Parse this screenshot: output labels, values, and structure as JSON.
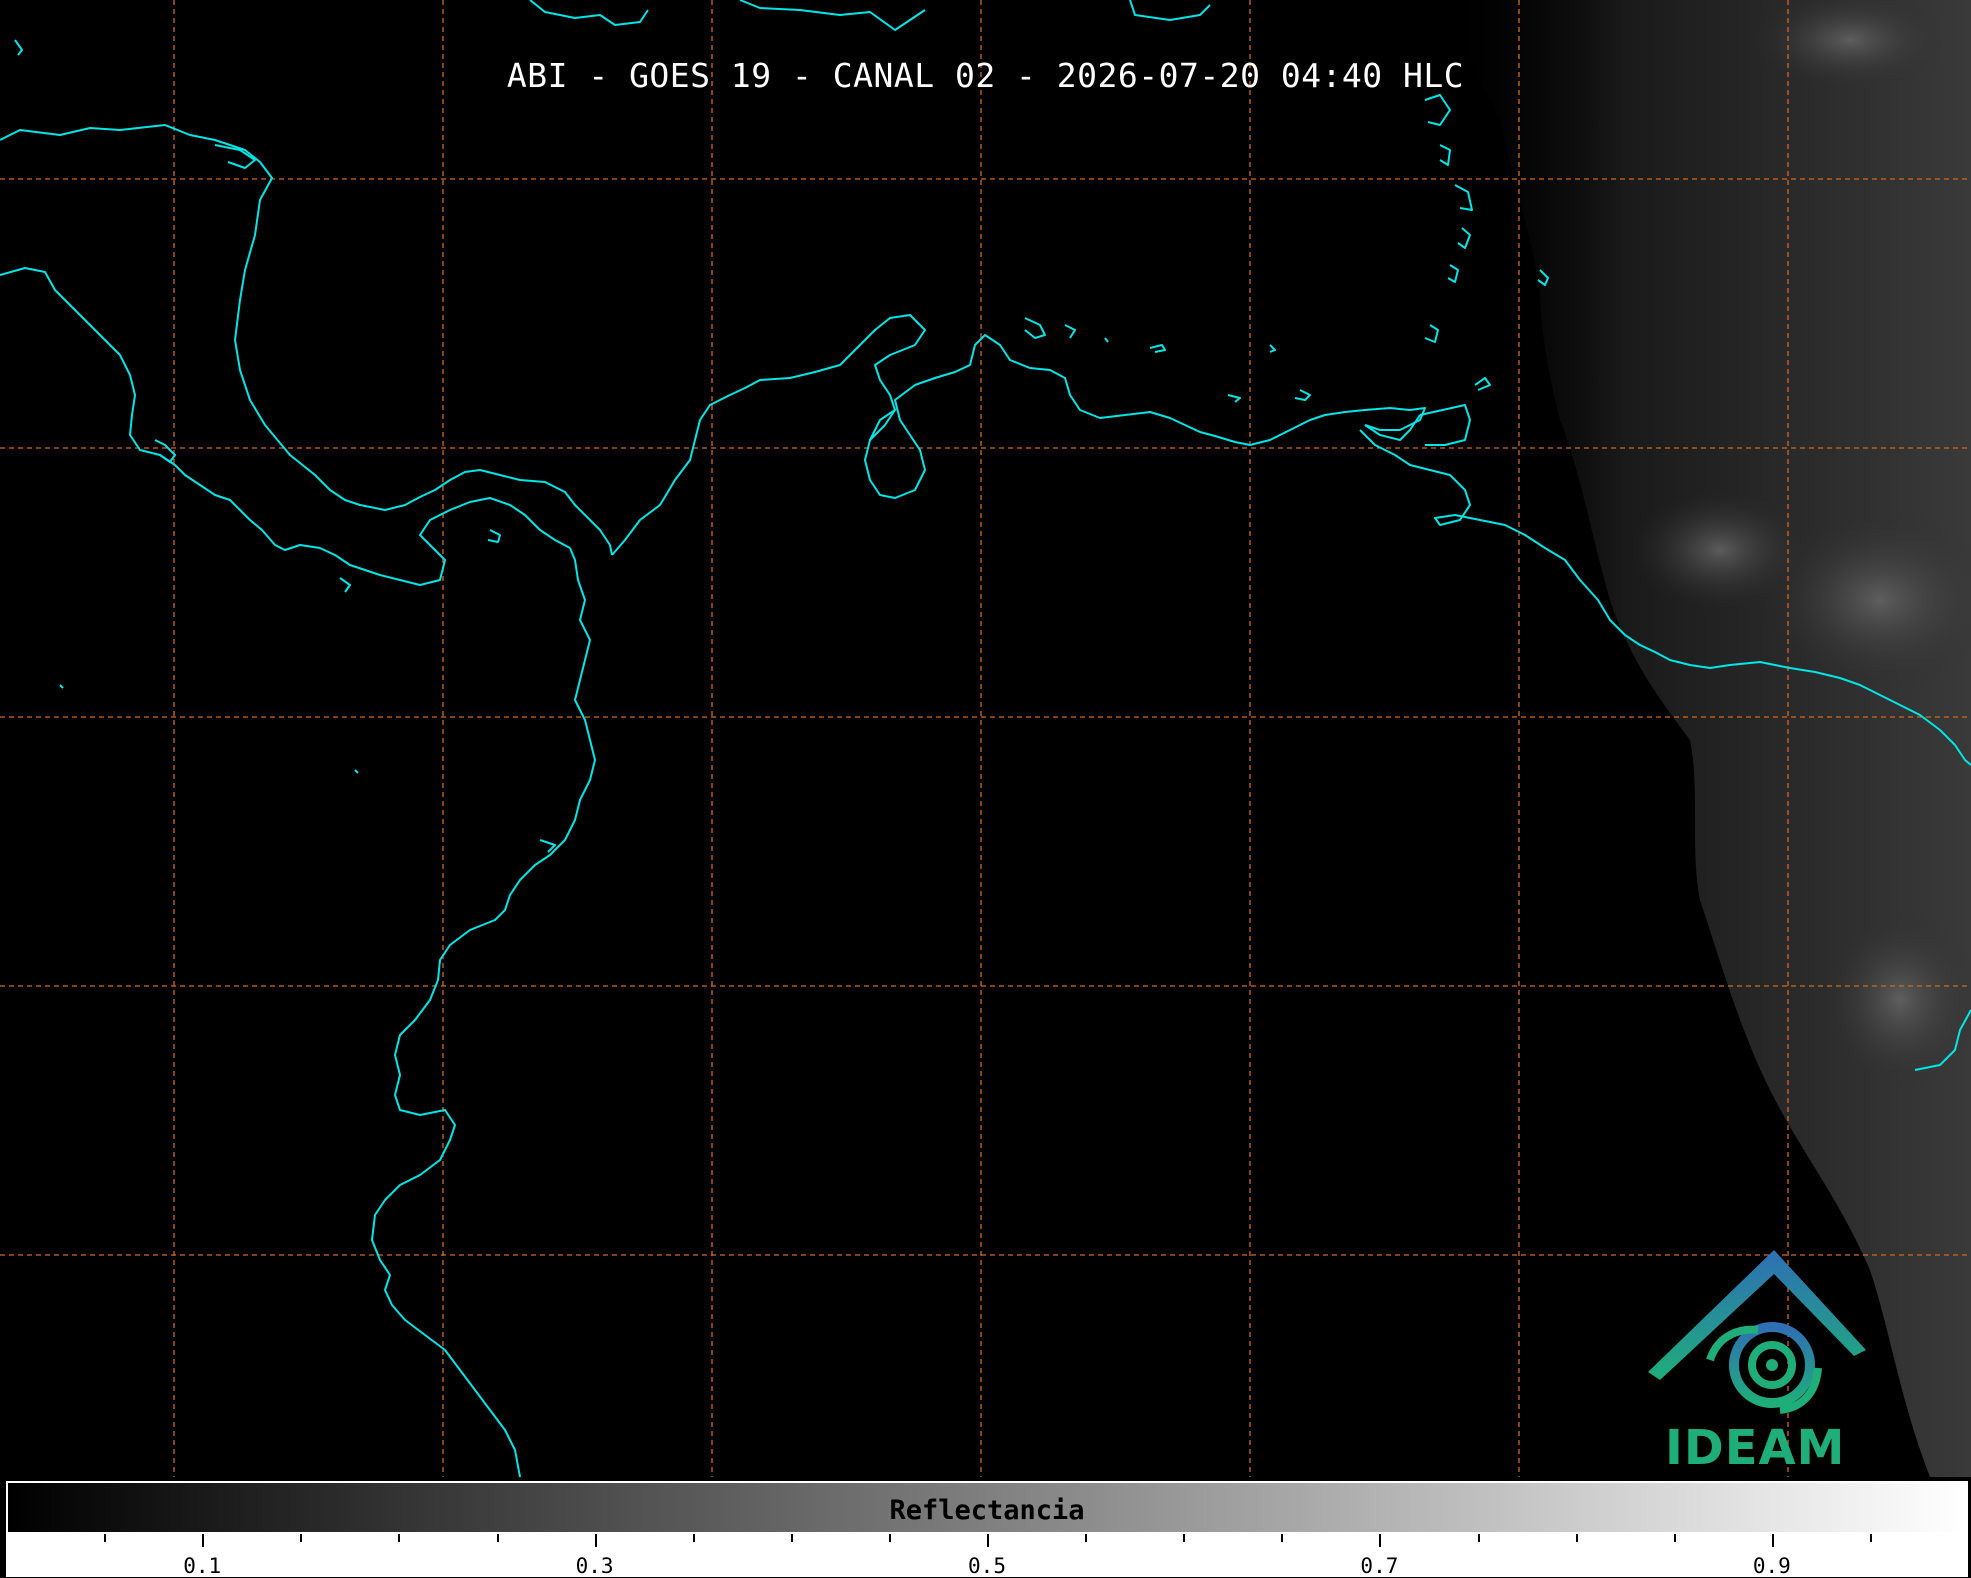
{
  "title": "ABI - GOES 19 - CANAL 02 - 2026-07-20 04:40 HLC",
  "logo": {
    "text": "IDEAM",
    "color_top": "#2f6fb5",
    "color_bottom": "#1fae7a"
  },
  "colorbar": {
    "label": "Reflectancia",
    "range": [
      0,
      1
    ],
    "colormap": [
      "#000000",
      "#ffffff"
    ],
    "major_ticks": [
      "0.1",
      "0.3",
      "0.5",
      "0.7",
      "0.9"
    ]
  },
  "colors": {
    "coastline": "#00e5e5",
    "gridline": "#d2691e",
    "background": "#000000"
  }
}
